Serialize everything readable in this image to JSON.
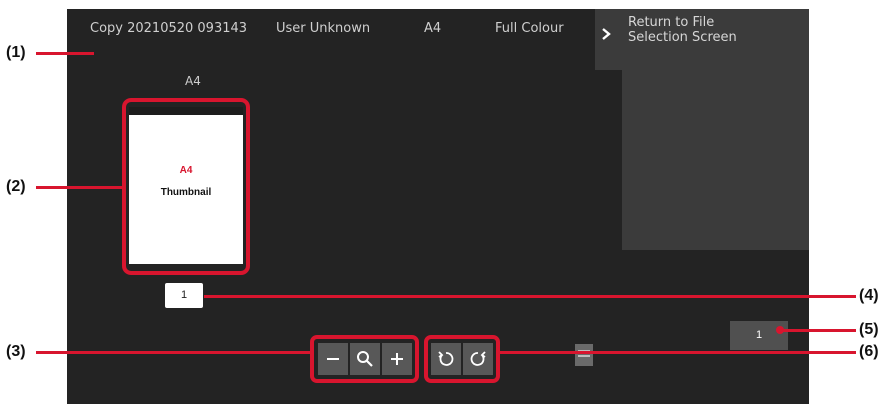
{
  "topbar": {
    "file_name": "Copy 20210520 093143",
    "user": "User Unknown",
    "paper_size": "A4",
    "color_mode": "Full Colour"
  },
  "return_button": {
    "label": "Return to File Selection Screen",
    "icon": "chevron-right-icon"
  },
  "preview": {
    "size_label": "A4",
    "thumbnail_size": "A4",
    "thumbnail_text": "Thumbnail",
    "page_number": "1"
  },
  "page_counter": "1",
  "zoom_controls": {
    "zoom_out_icon": "minus-icon",
    "magnify_icon": "magnifier-icon",
    "zoom_in_icon": "plus-icon"
  },
  "rotate_controls": {
    "rotate_left_icon": "rotate-left-icon",
    "rotate_right_icon": "rotate-right-icon"
  },
  "print_icon": "print-icon",
  "callouts": {
    "c1": "(1)",
    "c2": "(2)",
    "c3": "(3)",
    "c4": "(4)",
    "c5": "(5)",
    "c6": "(6)"
  },
  "colors": {
    "screen_bg": "#232323",
    "panel_bg": "#3b3b3b",
    "callout": "#d8152e"
  }
}
